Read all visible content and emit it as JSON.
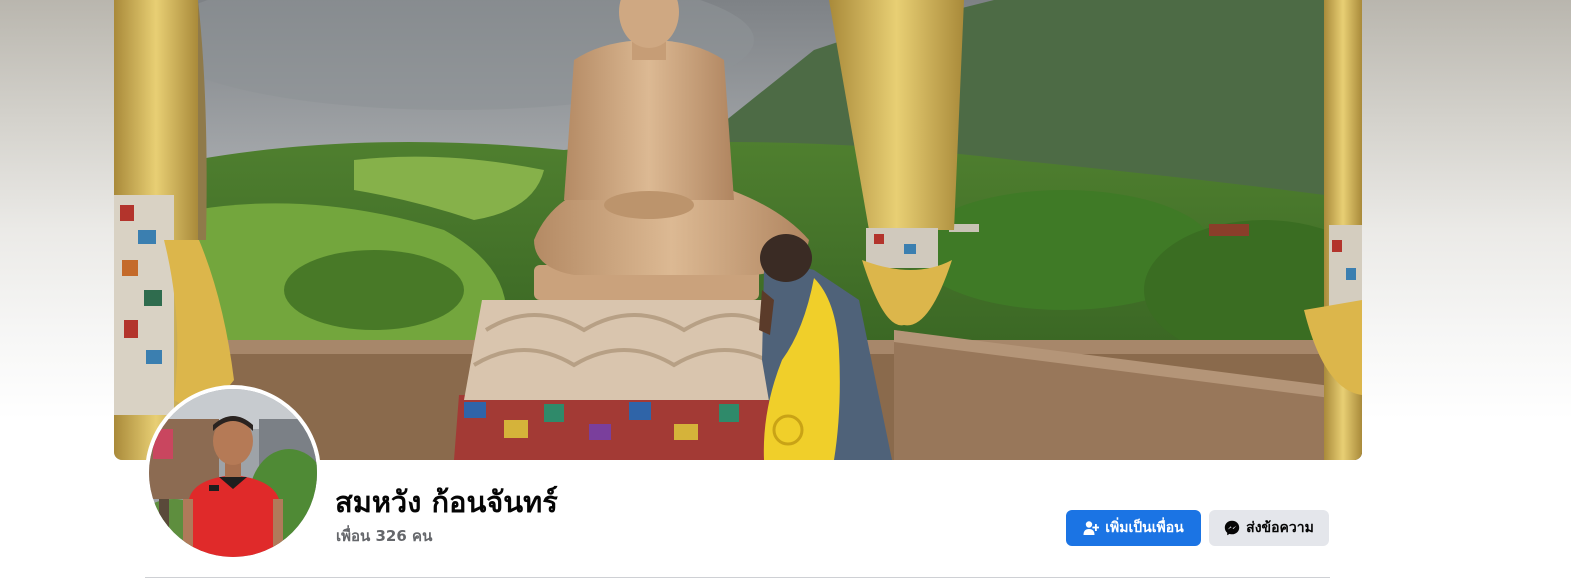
{
  "profile": {
    "name": "สมหวัง ก้อนจันทร์",
    "friend_count_text": "เพื่อน 326 คน"
  },
  "actions": {
    "add_friend_label": "เพิ่มเป็นเพื่อน",
    "message_label": "ส่งข้อความ"
  },
  "icons": {
    "add_friend": "add-friend-icon",
    "messenger": "messenger-icon"
  },
  "colors": {
    "primary_button": "#1b74e4",
    "secondary_button": "#e4e6eb",
    "name_text": "#050505",
    "secondary_text": "#65676b"
  }
}
